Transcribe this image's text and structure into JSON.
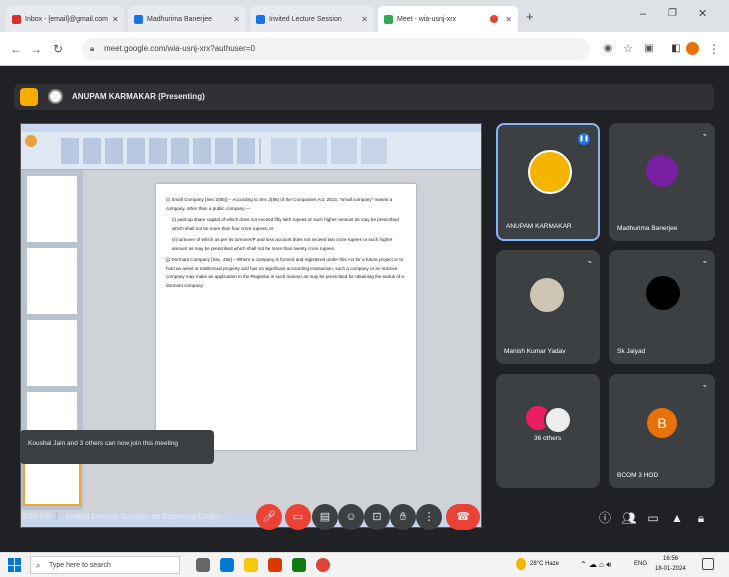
{
  "browser": {
    "tabs": [
      {
        "label": "Inbox - [email]@gmail.com",
        "color": "#d93025"
      },
      {
        "label": "Madhurima Banerjee",
        "color": "#1a73e8"
      },
      {
        "label": "Invited Lecture Session",
        "color": "#1a73e8"
      },
      {
        "label": "Meet - wia-usnj-xrx",
        "color": "#34a853"
      }
    ],
    "url": "meet.google.com/wia-usnj-xrx?authuser=0"
  },
  "presenter": {
    "label": "ANUPAM KARMAKAR (Presenting)"
  },
  "document": {
    "paragraphs": [
      "(i) Small Company [Sec 2(85)] – According to Sec 2(85) of the Companies Act, 2013, \"small company\" means a company, other than a public company —",
      "(i) paid-up share capital of which does not exceed fifty lakh rupees or such higher amount as may be prescribed which shall not be more than four crore rupees; or",
      "(ii) turnover of which as per its turnover/P and loss account does not exceed two crore rupees or such higher amount as may be prescribed which shall not be more than twenty crore rupees.",
      "(j) Dormant Company [Sec. 455] – Where a company is formed and registered under this Act for a future project or to hold an asset or intellectual property and has no significant accounting transaction, such a company or an inactive company may make an application to the Registrar in such manner as may be prescribed for obtaining the status of a dormant company."
    ]
  },
  "toast": {
    "text": "Koushal Jain and 3 others can now join this meeting"
  },
  "participants": [
    {
      "name": "ANUPAM KARMAKAR",
      "avatar_color": "#f4b400",
      "speaking": true
    },
    {
      "name": "Madhurima Banerjee",
      "avatar_color": "#7b1fa2"
    },
    {
      "name": "Manish Kumar Yadav",
      "avatar_color": "#cfc5b5"
    },
    {
      "name": "Sk Jaiyad",
      "avatar_color": "#000000"
    },
    {
      "name": "36 others",
      "avatar_color": "#e91e63"
    },
    {
      "name": "BCOM 3 HOD",
      "initial": "B",
      "avatar_color": "#e8710a"
    }
  ],
  "meeting": {
    "time": "4:56 PM",
    "separator": "|",
    "title": "Invited Lecture Session on Exploring Corpo..."
  },
  "taskbar": {
    "search_placeholder": "Type here to search",
    "weather": "28°C Haze",
    "language": "ENG",
    "time": "16:56",
    "date": "18-01-2024"
  },
  "colors": {
    "meet_bg": "#202124",
    "tile_bg": "#3c4043",
    "end_call": "#ea4335",
    "active_border": "#8ab4f8"
  }
}
